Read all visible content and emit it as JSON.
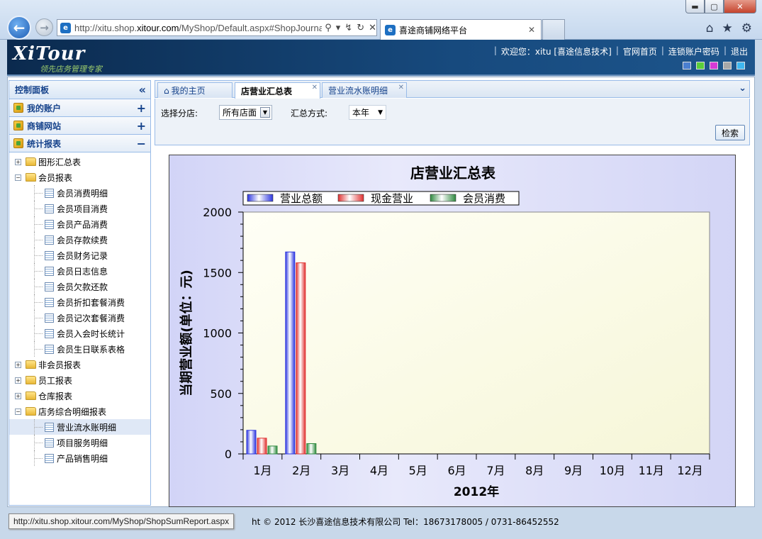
{
  "browser": {
    "window_buttons": {
      "minimize": "▬",
      "maximize": "▢",
      "close": "✕"
    },
    "address": {
      "url_prefix": "http://xitu.shop.",
      "url_domain": "xitour.com",
      "url_suffix": "/MyShop/Default.aspx#ShopJourna"
    },
    "tab_title": "喜途商铺网络平台",
    "tab_close": "✕",
    "icons": [
      "home-icon",
      "star-icon",
      "gear-icon"
    ]
  },
  "site": {
    "logo": "XiTour",
    "slogan": "领先店务管理专家",
    "welcome": "欢迎您：xitu [喜途信息技术]",
    "links": [
      "官网首页",
      "连锁账户密码",
      "退出"
    ],
    "theme_colors": [
      "#4a7fd0",
      "#5bcf3a",
      "#d63ad6",
      "#a8a8a8",
      "#3fb7f0"
    ]
  },
  "sidebar": {
    "title": "控制面板",
    "accordion": [
      {
        "label": "我的账户",
        "state": "+"
      },
      {
        "label": "商铺网站",
        "state": "+"
      },
      {
        "label": "统计报表",
        "state": "−"
      }
    ],
    "tree": {
      "graph_summary": "图形汇总表",
      "member_reports": "会员报表",
      "member_items": [
        "会员消费明细",
        "会员项目消费",
        "会员产品消费",
        "会员存款续费",
        "会员财务记录",
        "会员日志信息",
        "会员欠款还款",
        "会员折扣套餐消费",
        "会员记次套餐消费",
        "会员入会时长统计",
        "会员生日联系表格"
      ],
      "non_member_reports": "非会员报表",
      "staff_reports": "员工报表",
      "warehouse_reports": "仓库报表",
      "store_detail_reports": "店务综合明细报表",
      "store_items": [
        "营业流水账明细",
        "项目服务明细",
        "产品销售明细"
      ]
    }
  },
  "tabs": [
    {
      "label": "我的主页"
    },
    {
      "label": "店营业汇总表"
    },
    {
      "label": "营业流水账明细"
    }
  ],
  "filters": {
    "branch_label": "选择分店:",
    "branch_value": "所有店面",
    "mode_label": "汇总方式:",
    "mode_value": "本年",
    "search_button": "检索"
  },
  "chart_data": {
    "type": "bar",
    "title": "店营业汇总表",
    "xlabel": "2012年",
    "ylabel": "当期营业额(单位：元)",
    "ylim": [
      0,
      2000
    ],
    "yticks": [
      0,
      500,
      1000,
      1500,
      2000
    ],
    "categories": [
      "1月",
      "2月",
      "3月",
      "4月",
      "5月",
      "6月",
      "7月",
      "8月",
      "9月",
      "10月",
      "11月",
      "12月"
    ],
    "series": [
      {
        "name": "营业总额",
        "color": "#2d36e0",
        "values": [
          195,
          1670,
          0,
          0,
          0,
          0,
          0,
          0,
          0,
          0,
          0,
          0
        ]
      },
      {
        "name": "现金营业",
        "color": "#e03030",
        "values": [
          130,
          1580,
          0,
          0,
          0,
          0,
          0,
          0,
          0,
          0,
          0,
          0
        ]
      },
      {
        "name": "会员消费",
        "color": "#2e8a3e",
        "values": [
          65,
          85,
          0,
          0,
          0,
          0,
          0,
          0,
          0,
          0,
          0,
          0
        ]
      }
    ],
    "legend_position": "top-left",
    "grid": false
  },
  "status": {
    "link_tip": "http://xitu.shop.xitour.com/MyShop/ShopSumReport.aspx",
    "footer": "ht © 2012 长沙喜途信息技术有限公司  Tel：18673178005 / 0731-86452552"
  }
}
